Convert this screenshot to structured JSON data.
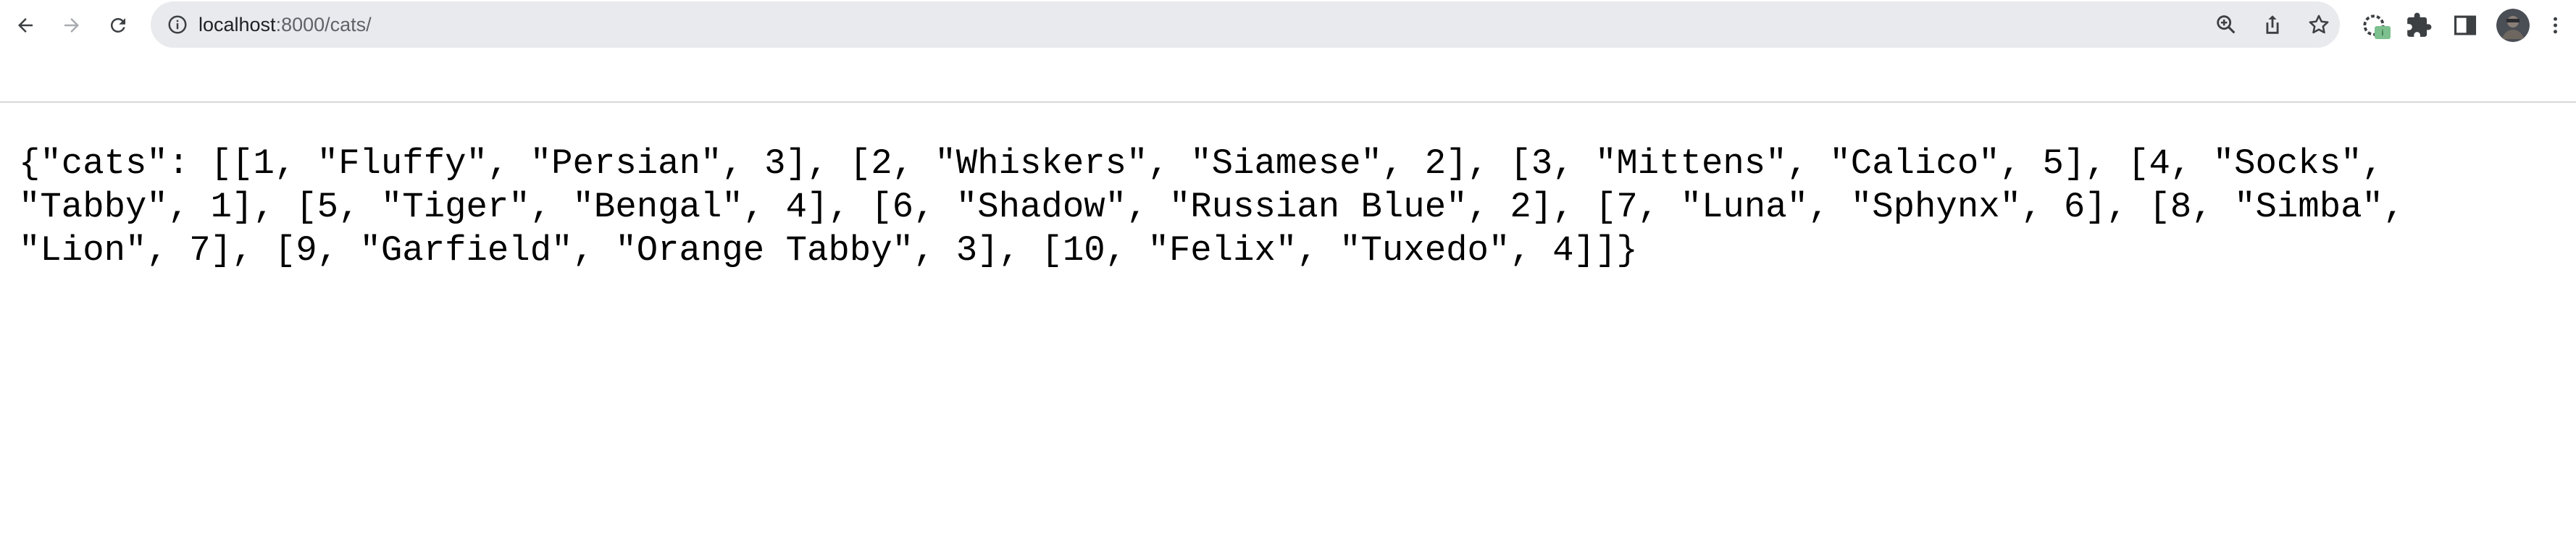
{
  "browser": {
    "url_host": "localhost",
    "url_rest": ":8000/cats/",
    "icons": {
      "back": "arrow-left-icon",
      "forward": "arrow-right-icon",
      "reload": "reload-icon",
      "site_info": "info-circle-icon",
      "zoom": "zoom-icon",
      "share": "share-icon",
      "bookmark": "star-icon",
      "extension_status": "loading-extension-icon",
      "extensions": "puzzle-icon",
      "side_panel": "side-panel-icon",
      "profile": "avatar",
      "menu": "kebab-menu-icon"
    },
    "extension_badge": "i"
  },
  "page": {
    "body_text": "{\"cats\": [[1, \"Fluffy\", \"Persian\", 3], [2, \"Whiskers\", \"Siamese\", 2], [3, \"Mittens\", \"Calico\", 5], [4, \"Socks\", \"Tabby\", 1], [5, \"Tiger\", \"Bengal\", 4], [6, \"Shadow\", \"Russian Blue\", 2], [7, \"Luna\", \"Sphynx\", 6], [8, \"Simba\", \"Lion\", 7], [9, \"Garfield\", \"Orange Tabby\", 3], [10, \"Felix\", \"Tuxedo\", 4]]}"
  }
}
